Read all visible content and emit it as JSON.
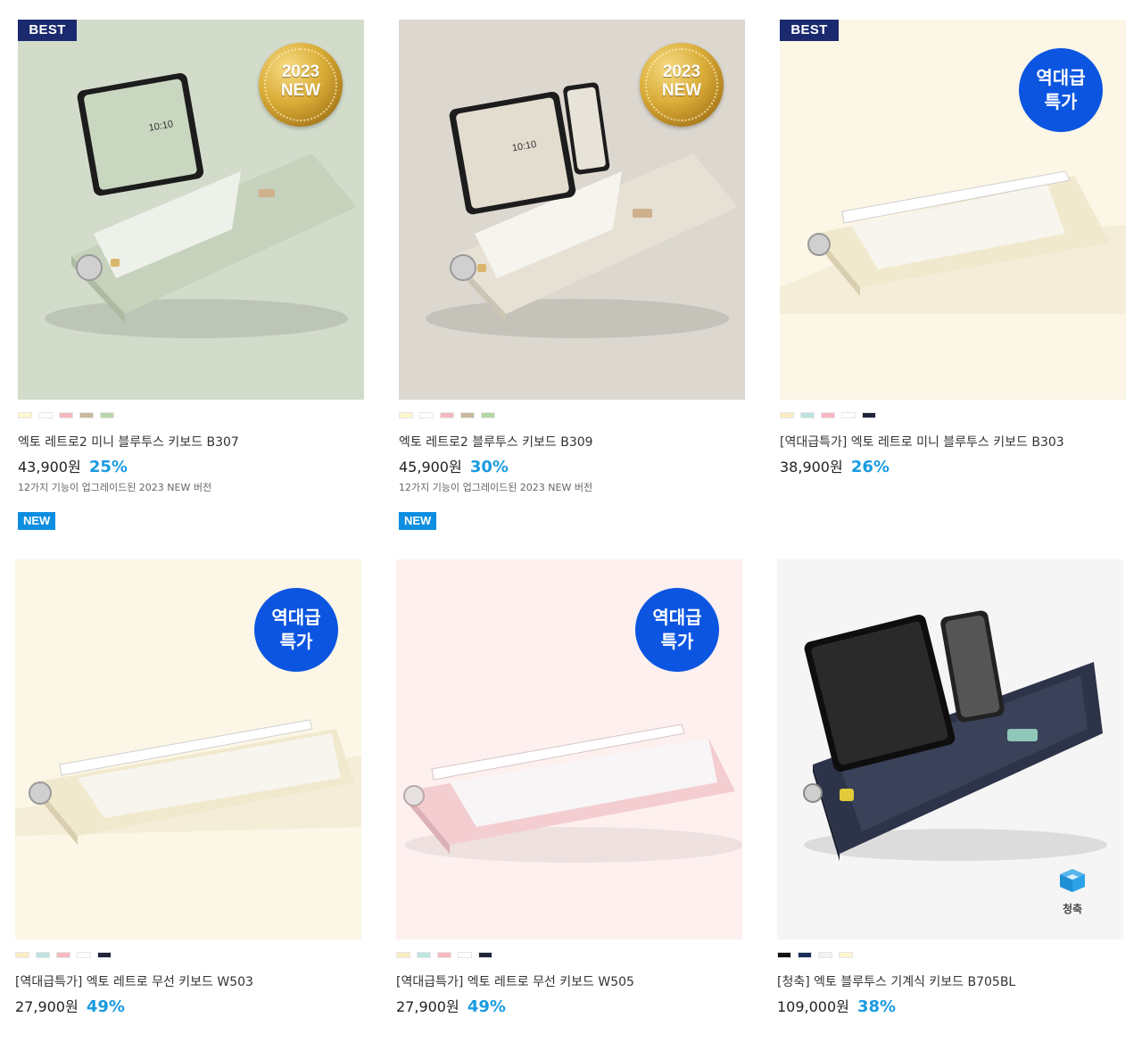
{
  "products": [
    {
      "best": "BEST",
      "medal": "2023\nNEW",
      "swatches": [
        "#fdf6cf",
        "#ffffff",
        "#f4b8bf",
        "#c9b99c",
        "#b6d6a8"
      ],
      "name": "엑토 레트로2 미니 블루투스 키보드 B307",
      "price": "43,900원",
      "discount": "25%",
      "desc": "12가지 기능이 업그레이드된 2023 NEW 버전",
      "new_badge": "NEW",
      "bg": "#d3dccb",
      "body_color": "#c8d4bd"
    },
    {
      "medal": "2023\nNEW",
      "swatches": [
        "#fdf6cf",
        "#ffffff",
        "#f4b8bf",
        "#c9b99c",
        "#b6d6a8"
      ],
      "name": "엑토 레트로2 블루투스 키보드 B309",
      "price": "45,900원",
      "discount": "30%",
      "desc": "12가지 기능이 업그레이드된 2023 NEW 버전",
      "new_badge": "NEW",
      "bg": "#dcd8d0",
      "body_color": "#e7e2d6"
    },
    {
      "best": "BEST",
      "deal": "역대급\n특가",
      "swatches": [
        "#fbedc3",
        "#bde3e0",
        "#f7b9c1",
        "#ffffff",
        "#20253c"
      ],
      "name": "[역대급특가] 엑토 레트로 미니 블루투스 키보드 B303",
      "price": "38,900원",
      "discount": "26%",
      "bg": "#fcf6e6",
      "body_color": "#f2ead0"
    },
    {
      "deal": "역대급\n특가",
      "swatches": [
        "#fbedc3",
        "#bde3e0",
        "#f7b9c1",
        "#ffffff",
        "#20253c"
      ],
      "name": "[역대급특가] 엑토 레트로 무선 키보드 W503",
      "price": "27,900원",
      "discount": "49%",
      "bg": "#fcf6e6",
      "body_color": "#f2ead0"
    },
    {
      "deal": "역대급\n특가",
      "swatches": [
        "#fbedc3",
        "#bde3e0",
        "#f7b9c1",
        "#ffffff",
        "#20253c"
      ],
      "name": "[역대급특가] 엑토 레트로 무선 키보드 W505",
      "price": "27,900원",
      "discount": "49%",
      "bg": "#fdf0ef",
      "body_color": "#f6cfd2"
    },
    {
      "cheongchuk": "청축",
      "swatches": [
        "#111111",
        "#1b2e5a",
        "#f2f2f2",
        "#fdf6cf"
      ],
      "name": "[청축] 엑토 블루투스 기계식 키보드 B705BL",
      "price": "109,000원",
      "discount": "38%",
      "bg": "#f5f5f5",
      "body_color": "#2a3146"
    }
  ]
}
